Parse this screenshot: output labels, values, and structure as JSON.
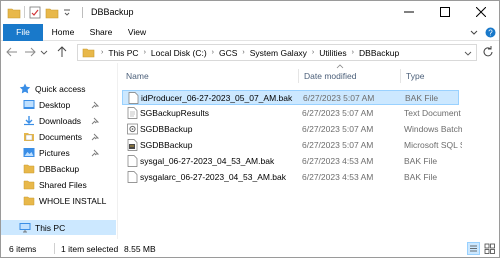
{
  "window": {
    "title": "DBBackup",
    "minimize_icon": "minimize-icon",
    "maximize_icon": "maximize-icon",
    "close_icon": "close-icon"
  },
  "ribbon": {
    "tabs": [
      "File",
      "Home",
      "Share",
      "View"
    ],
    "file_tab_color": "#1979ca"
  },
  "address": {
    "crumbs": [
      "This PC",
      "Local Disk (C:)",
      "GCS",
      "System Galaxy",
      "Utilities",
      "DBBackup"
    ]
  },
  "nav": {
    "items": [
      {
        "label": "Quick access",
        "icon": "star-icon",
        "pinned": false
      },
      {
        "label": "Desktop",
        "icon": "desktop-folder-icon",
        "pinned": true
      },
      {
        "label": "Downloads",
        "icon": "download-folder-icon",
        "pinned": true
      },
      {
        "label": "Documents",
        "icon": "documents-folder-icon",
        "pinned": true
      },
      {
        "label": "Pictures",
        "icon": "pictures-folder-icon",
        "pinned": true
      },
      {
        "label": "DBBackup",
        "icon": "folder-icon",
        "pinned": false
      },
      {
        "label": "Shared Files",
        "icon": "folder-icon",
        "pinned": false
      },
      {
        "label": "WHOLE INSTALL",
        "icon": "folder-icon",
        "pinned": false
      },
      {
        "label": "This PC",
        "icon": "computer-icon",
        "pinned": false
      }
    ]
  },
  "columns": {
    "name": "Name",
    "date": "Date modified",
    "type": "Type"
  },
  "files": [
    {
      "name": "idProducer_06-27-2023_05_07_AM.bak",
      "date": "6/27/2023 5:07 AM",
      "type": "BAK File",
      "icon": "file-icon",
      "selected": true
    },
    {
      "name": "SGBackupResults",
      "date": "6/27/2023 5:07 AM",
      "type": "Text Document",
      "icon": "text-file-icon",
      "selected": false
    },
    {
      "name": "SGDBBackup",
      "date": "6/27/2023 5:07 AM",
      "type": "Windows Batch File",
      "icon": "batch-file-icon",
      "selected": false
    },
    {
      "name": "SGDBBackup",
      "date": "6/27/2023 5:07 AM",
      "type": "Microsoft SQL Server",
      "icon": "sql-file-icon",
      "selected": false
    },
    {
      "name": "sysgal_06-27-2023_04_53_AM.bak",
      "date": "6/27/2023 4:53 AM",
      "type": "BAK File",
      "icon": "file-icon",
      "selected": false
    },
    {
      "name": "sysgalarc_06-27-2023_04_53_AM.bak",
      "date": "6/27/2023 4:53 AM",
      "type": "BAK File",
      "icon": "file-icon",
      "selected": false
    }
  ],
  "status": {
    "items": "6 items",
    "selected": "1 item selected",
    "size": "8.55 MB"
  },
  "colors": {
    "selection": "#cce8ff",
    "selection_border": "#99d1ff",
    "folder": "#e8b84a"
  }
}
